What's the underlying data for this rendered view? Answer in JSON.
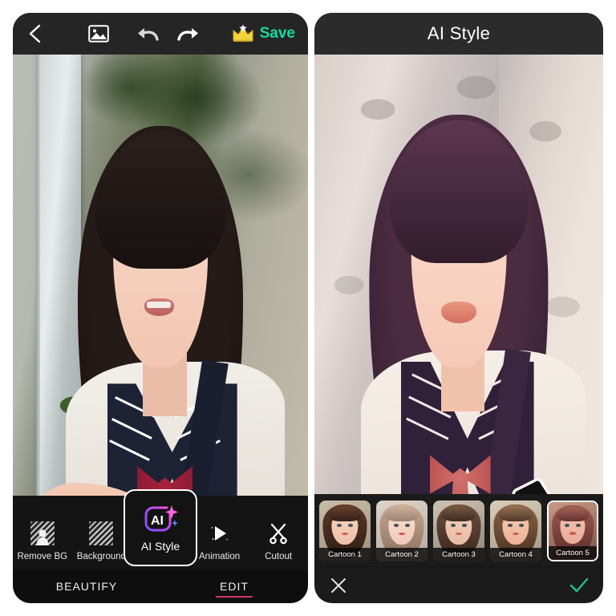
{
  "app": {
    "left_panel": {
      "topbar": {
        "back_icon": "chevron-left-icon",
        "photo_icon": "image-picker-icon",
        "undo_icon": "undo-arrow-icon",
        "redo_icon": "redo-arrow-icon",
        "pro_icon": "crown-icon",
        "save_label": "Save",
        "save_color": "#11dca0"
      },
      "tools": [
        {
          "label": "Remove BG",
          "icon": "remove-background-icon"
        },
        {
          "label": "Background",
          "icon": "background-pattern-icon"
        },
        {
          "label": "AI Style",
          "icon": "ai-sparkle-icon",
          "selected": true
        },
        {
          "label": "Animation",
          "icon": "play-triangle-icon"
        },
        {
          "label": "Cutout",
          "icon": "scissors-icon"
        }
      ],
      "tabs": [
        {
          "label": "BEAUTIFY",
          "active": false
        },
        {
          "label": "EDIT",
          "active": true
        }
      ],
      "tab_accent_color": "#d6346a"
    },
    "right_panel": {
      "topbar": {
        "title": "AI Style"
      },
      "styles": [
        {
          "label": "Cartoon 1",
          "selected": false
        },
        {
          "label": "Cartoon 2",
          "selected": false
        },
        {
          "label": "Cartoon 3",
          "selected": false
        },
        {
          "label": "Cartoon 4",
          "selected": false
        },
        {
          "label": "Cartoon 5",
          "selected": true
        }
      ],
      "actions": {
        "cancel_icon": "close-x-icon",
        "confirm_icon": "check-mark-icon",
        "confirm_color": "#21c08f"
      },
      "annotation": {
        "icon": "curved-arrow-annotation"
      }
    }
  }
}
